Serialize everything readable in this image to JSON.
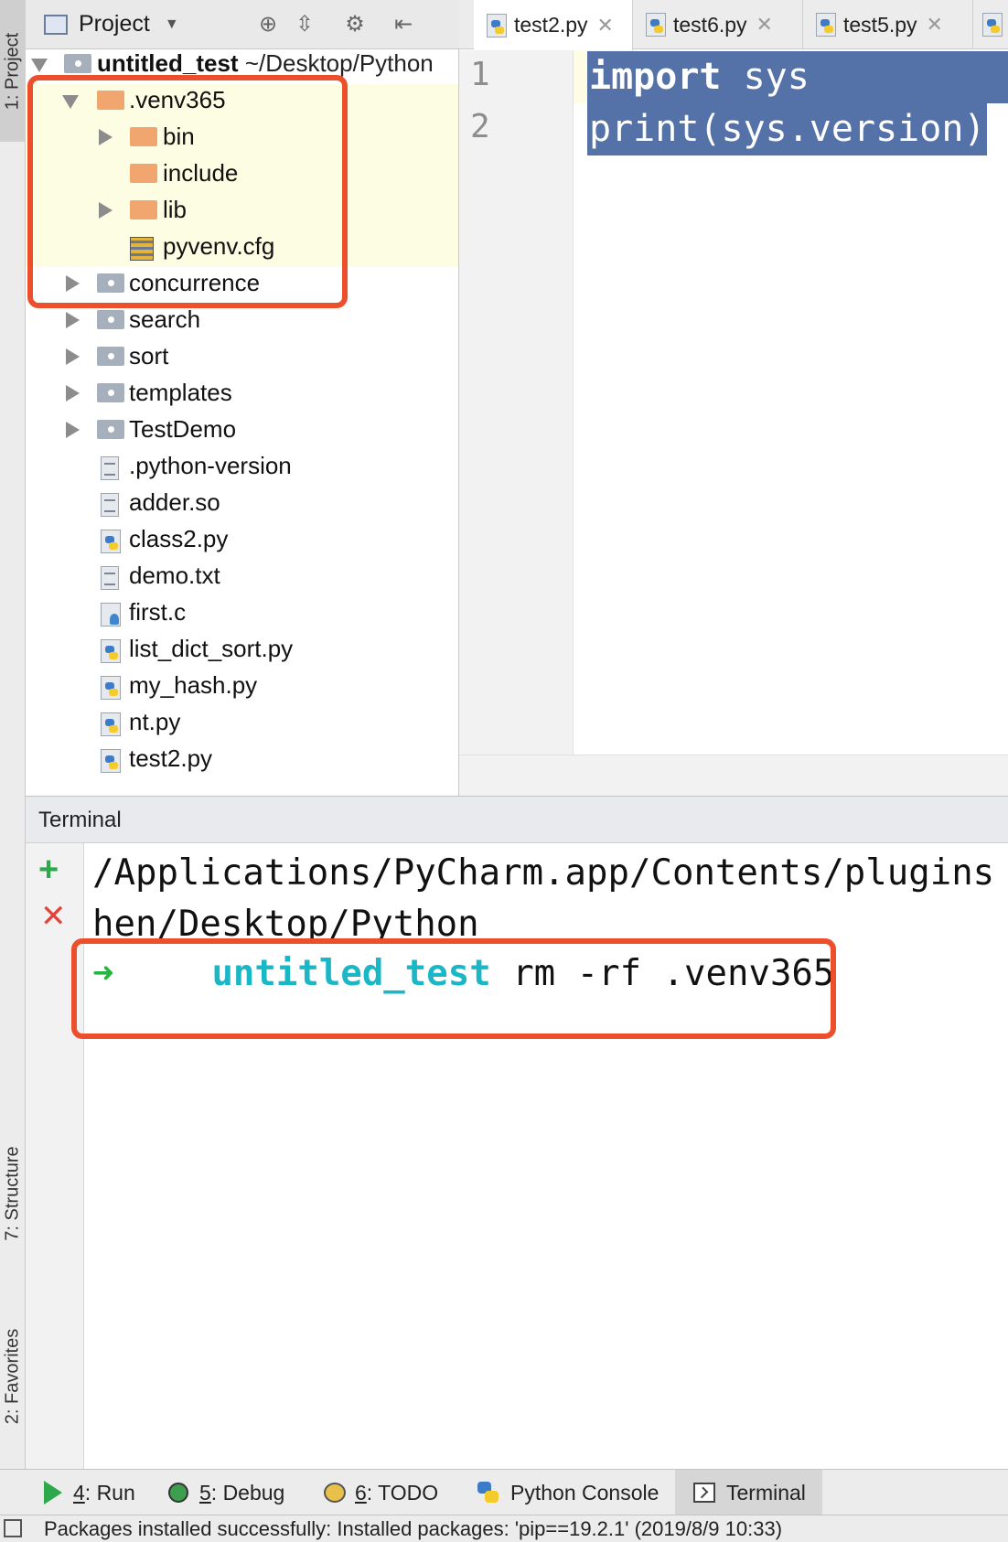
{
  "left_stripe": {
    "project_tab": "1: Project",
    "structure_tab": "7: Structure",
    "favorites_tab": "2: Favorites"
  },
  "project_panel": {
    "title": "Project",
    "root_name": "untitled_test",
    "root_path": "~/Desktop/Python",
    "items": [
      {
        "label": ".venv365",
        "type": "folder-excluded",
        "expanded": true
      },
      {
        "label": "bin",
        "type": "folder-excluded",
        "expanded": false
      },
      {
        "label": "include",
        "type": "folder-excluded"
      },
      {
        "label": "lib",
        "type": "folder-excluded",
        "expanded": false
      },
      {
        "label": "pyvenv.cfg",
        "type": "config-file"
      },
      {
        "label": "concurrence",
        "type": "package"
      },
      {
        "label": "search",
        "type": "package"
      },
      {
        "label": "sort",
        "type": "package"
      },
      {
        "label": "templates",
        "type": "package"
      },
      {
        "label": "TestDemo",
        "type": "package"
      },
      {
        "label": ".python-version",
        "type": "text-file"
      },
      {
        "label": "adder.so",
        "type": "text-file"
      },
      {
        "label": "class2.py",
        "type": "python-file"
      },
      {
        "label": "demo.txt",
        "type": "text-file"
      },
      {
        "label": "first.c",
        "type": "c-file"
      },
      {
        "label": "list_dict_sort.py",
        "type": "python-file"
      },
      {
        "label": "my_hash.py",
        "type": "python-file"
      },
      {
        "label": "nt.py",
        "type": "python-file"
      },
      {
        "label": "test2.py",
        "type": "python-file"
      }
    ]
  },
  "editor": {
    "tabs": [
      {
        "label": "test2.py",
        "active": true
      },
      {
        "label": "test6.py",
        "active": false
      },
      {
        "label": "test5.py",
        "active": false
      }
    ],
    "line_numbers": [
      "1",
      "2"
    ],
    "lines": [
      {
        "keyword": "import",
        "rest": " sys"
      },
      {
        "keyword": "",
        "rest": "print(sys.version)"
      }
    ]
  },
  "terminal": {
    "title": "Terminal",
    "output_line_1": "/Applications/PyCharm.app/Contents/plugins",
    "output_line_2": "hen/Desktop/Python",
    "prompt_arrow": "➜",
    "prompt_dir": "untitled_test",
    "command": "rm -rf .venv365"
  },
  "toolbar": {
    "run_num": "4",
    "run_label": ": Run",
    "debug_num": "5",
    "debug_label": ": Debug",
    "todo_num": "6",
    "todo_label": ": TODO",
    "python_console": "Python Console",
    "terminal": "Terminal"
  },
  "status_bar": {
    "message": "Packages installed successfully: Installed packages: 'pip==19.2.1' (2019/8/9 10:33)"
  },
  "colors": {
    "highlight_box": "#ec4f2c",
    "selection": "#5472a8",
    "prompt_dir": "#1ab7c7",
    "prompt_arrow": "#28b440",
    "excluded_folder": "#f0a66e"
  }
}
